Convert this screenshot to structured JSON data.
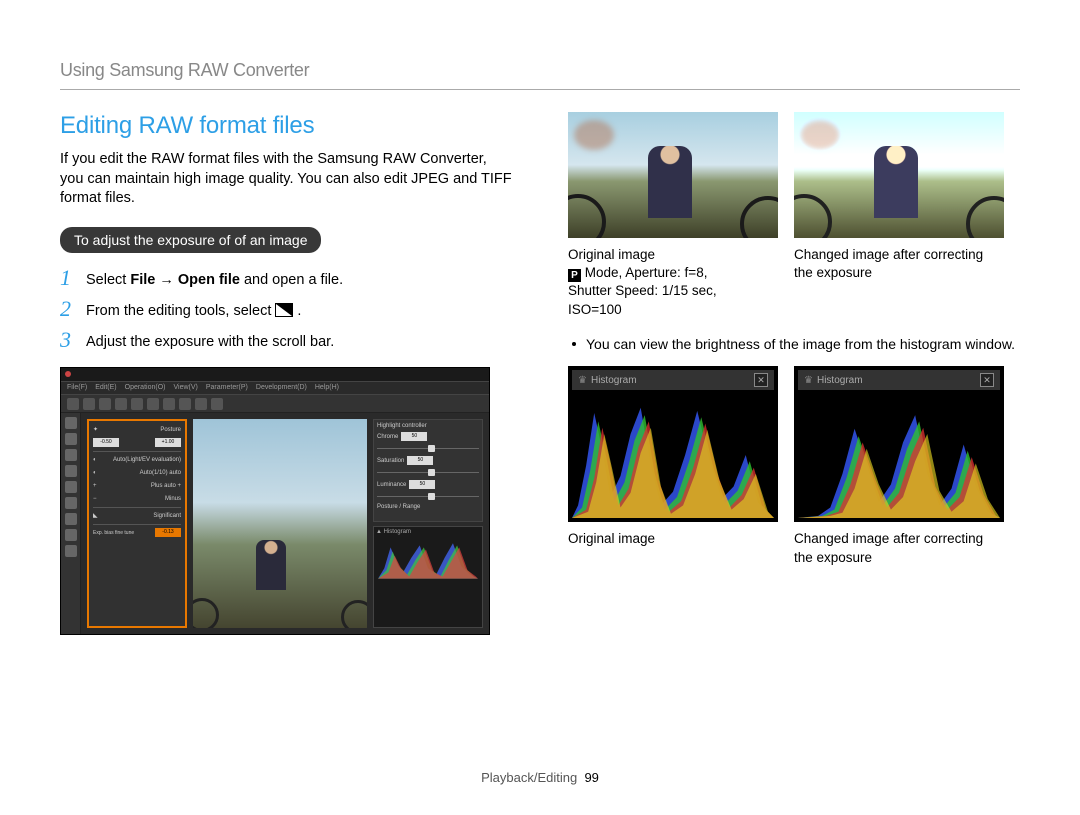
{
  "breadcrumb": "Using Samsung RAW Converter",
  "heading": "Editing RAW format files",
  "intro": "If you edit the RAW format files with the Samsung RAW Converter, you can maintain high image quality. You can also edit JPEG and TIFF format files.",
  "pill": "To adjust the exposure of of an image",
  "steps": [
    {
      "n": "1",
      "pre": "Select ",
      "bold": "File → Open file",
      "post": " and open a file."
    },
    {
      "n": "2",
      "pre": "From the editing tools, select ",
      "bold": "",
      "post": " ."
    },
    {
      "n": "3",
      "pre": "Adjust the exposure with the scroll bar.",
      "bold": "",
      "post": ""
    }
  ],
  "app": {
    "menus": [
      "File(F)",
      "Edit(E)",
      "Operation(O)",
      "View(V)",
      "Parameter(P)",
      "Development(D)",
      "Help(H)"
    ],
    "left_panel": {
      "title": "Posture",
      "bias_low": "-0.50",
      "bias_high": "+1.00",
      "rows": [
        "Auto(Light/EV evaluation)",
        "Auto(1/10) auto",
        "Plus auto +",
        "Minus  ",
        "Significant"
      ],
      "bottom_val": "-0.13"
    },
    "right_panel": {
      "title1": "Highlight controller",
      "sliders": [
        {
          "label": "Chrome",
          "val": "50",
          "pos": 50
        },
        {
          "label": "Saturation",
          "val": "50",
          "pos": 50
        },
        {
          "label": "Luminance",
          "val": "50",
          "pos": 50
        }
      ],
      "sub": "Posture / Range",
      "hist_label": "Histogram"
    }
  },
  "captions": {
    "orig1": "Original image",
    "orig_meta1": " Mode, Aperture: f=8,",
    "orig_meta2": "Shutter Speed: 1/15 sec,",
    "orig_meta3": "ISO=100",
    "mode_p": "P",
    "changed": "Changed image after correcting the exposure"
  },
  "note": "You can view the brightness of the image from the histogram window.",
  "hist_label": "Histogram",
  "hist_caption_left": "Original image",
  "hist_caption_right": "Changed image after correcting the exposure",
  "footer_section": "Playback/Editing",
  "footer_page": "99"
}
